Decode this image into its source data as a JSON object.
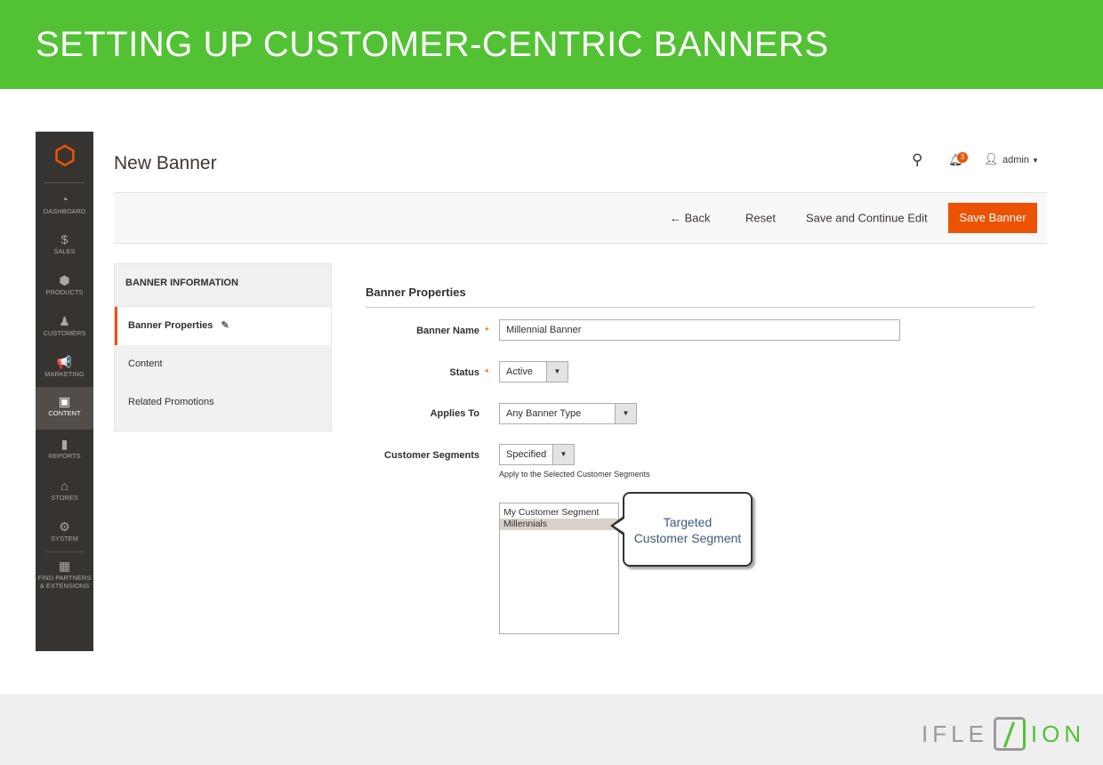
{
  "banner_title": "SETTING UP CUSTOMER-CENTRIC BANNERS",
  "sidebar": {
    "items": [
      {
        "label": "DASHBOARD",
        "icon": "dashboard-icon",
        "glyph": "◔"
      },
      {
        "label": "SALES",
        "icon": "dollar-icon",
        "glyph": "$"
      },
      {
        "label": "PRODUCTS",
        "icon": "box-icon",
        "glyph": "⬢"
      },
      {
        "label": "CUSTOMERS",
        "icon": "person-icon",
        "glyph": "♟"
      },
      {
        "label": "MARKETING",
        "icon": "megaphone-icon",
        "glyph": "📢"
      },
      {
        "label": "CONTENT",
        "icon": "layout-icon",
        "glyph": "▣"
      },
      {
        "label": "REPORTS",
        "icon": "bar-chart-icon",
        "glyph": "▮"
      },
      {
        "label": "STORES",
        "icon": "store-icon",
        "glyph": "⌂"
      },
      {
        "label": "SYSTEM",
        "icon": "gear-icon",
        "glyph": "⚙"
      },
      {
        "label": "FIND PARTNERS & EXTENSIONS",
        "icon": "blocks-icon",
        "glyph": "▦"
      }
    ]
  },
  "page": {
    "title": "New Banner",
    "notifications": "3",
    "user": "admin"
  },
  "toolbar": {
    "back": "← Back",
    "reset": "Reset",
    "save_continue": "Save and Continue Edit",
    "save": "Save Banner"
  },
  "nav": {
    "header": "BANNER INFORMATION",
    "items": [
      "Banner Properties",
      "Content",
      "Related Promotions"
    ]
  },
  "form": {
    "section": "Banner Properties",
    "name_label": "Banner Name",
    "name_value": "Millennial Banner",
    "status_label": "Status",
    "status_value": "Active",
    "applies_label": "Applies To",
    "applies_value": "Any Banner Type",
    "segments_label": "Customer Segments",
    "segments_value": "Specified",
    "segments_note": "Apply to the Selected Customer Segments",
    "segment_options": [
      "My Customer Segment",
      "Millennials"
    ]
  },
  "callout": {
    "line1": "Targeted",
    "line2": "Customer Segment"
  },
  "brand": {
    "logo": "IFLEXION",
    "accent": "#52c234",
    "magento_orange": "#eb5202"
  }
}
